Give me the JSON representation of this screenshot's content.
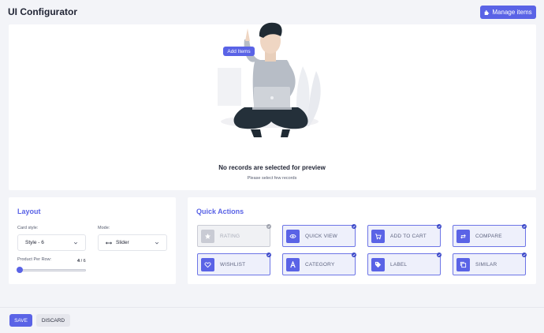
{
  "header": {
    "title": "UI Configurator",
    "manage_label": "Manage items"
  },
  "preview": {
    "add_items_label": "Add Items",
    "empty_title": "No records are selected for preview",
    "empty_subtitle": "Please select few records"
  },
  "layout": {
    "title": "Layout",
    "card_style_label": "Card style:",
    "card_style_value": "Style - 6",
    "mode_label": "Mode:",
    "mode_value": "Slider",
    "per_row_label": "Product Per Row:",
    "per_row_value": "4",
    "per_row_max": "/ 6",
    "per_row_fraction": 0.0
  },
  "quick_actions": {
    "title": "Quick Actions",
    "items": [
      {
        "label": "RATING",
        "icon": "star-icon",
        "enabled": false
      },
      {
        "label": "QUICK VIEW",
        "icon": "eye-icon",
        "enabled": true
      },
      {
        "label": "ADD TO CART",
        "icon": "cart-icon",
        "enabled": true
      },
      {
        "label": "COMPARE",
        "icon": "compare-arrows-icon",
        "enabled": true
      },
      {
        "label": "WISHLIST",
        "icon": "heart-icon",
        "enabled": true
      },
      {
        "label": "CATEGORY",
        "icon": "category-letter-icon",
        "enabled": true
      },
      {
        "label": "LABEL",
        "icon": "tag-icon",
        "enabled": true
      },
      {
        "label": "SIMILAR",
        "icon": "copy-icon",
        "enabled": true
      }
    ]
  },
  "footer": {
    "save_label": "SAVE",
    "discard_label": "DISCARD"
  },
  "colors": {
    "accent": "#5a63e6",
    "background": "#f3f4f8"
  }
}
